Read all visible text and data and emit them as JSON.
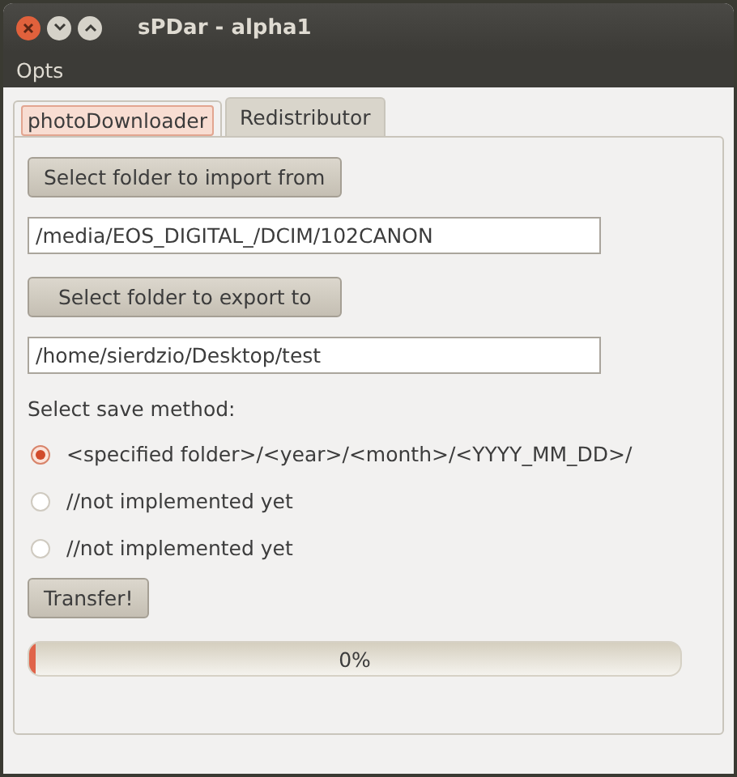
{
  "window": {
    "title": "sPDar - alpha1"
  },
  "menu": [
    "Opts"
  ],
  "tabs": [
    {
      "label": "photoDownloader",
      "selected": true
    },
    {
      "label": "Redistributor",
      "selected": false
    }
  ],
  "import_button": "Select folder to import from",
  "import_path": "/media/EOS_DIGITAL_/DCIM/102CANON",
  "export_button": "Select folder to export to",
  "export_path": "/home/sierdzio/Desktop/test",
  "save_method_label": "Select save method:",
  "save_methods": [
    {
      "label": "<specified folder>/<year>/<month>/<YYYY_MM_DD>/",
      "selected": true
    },
    {
      "label": "//not implemented yet",
      "selected": false
    },
    {
      "label": "//not implemented yet",
      "selected": false
    }
  ],
  "transfer_button": "Transfer!",
  "progress": {
    "level": 0,
    "reading": "0%"
  }
}
